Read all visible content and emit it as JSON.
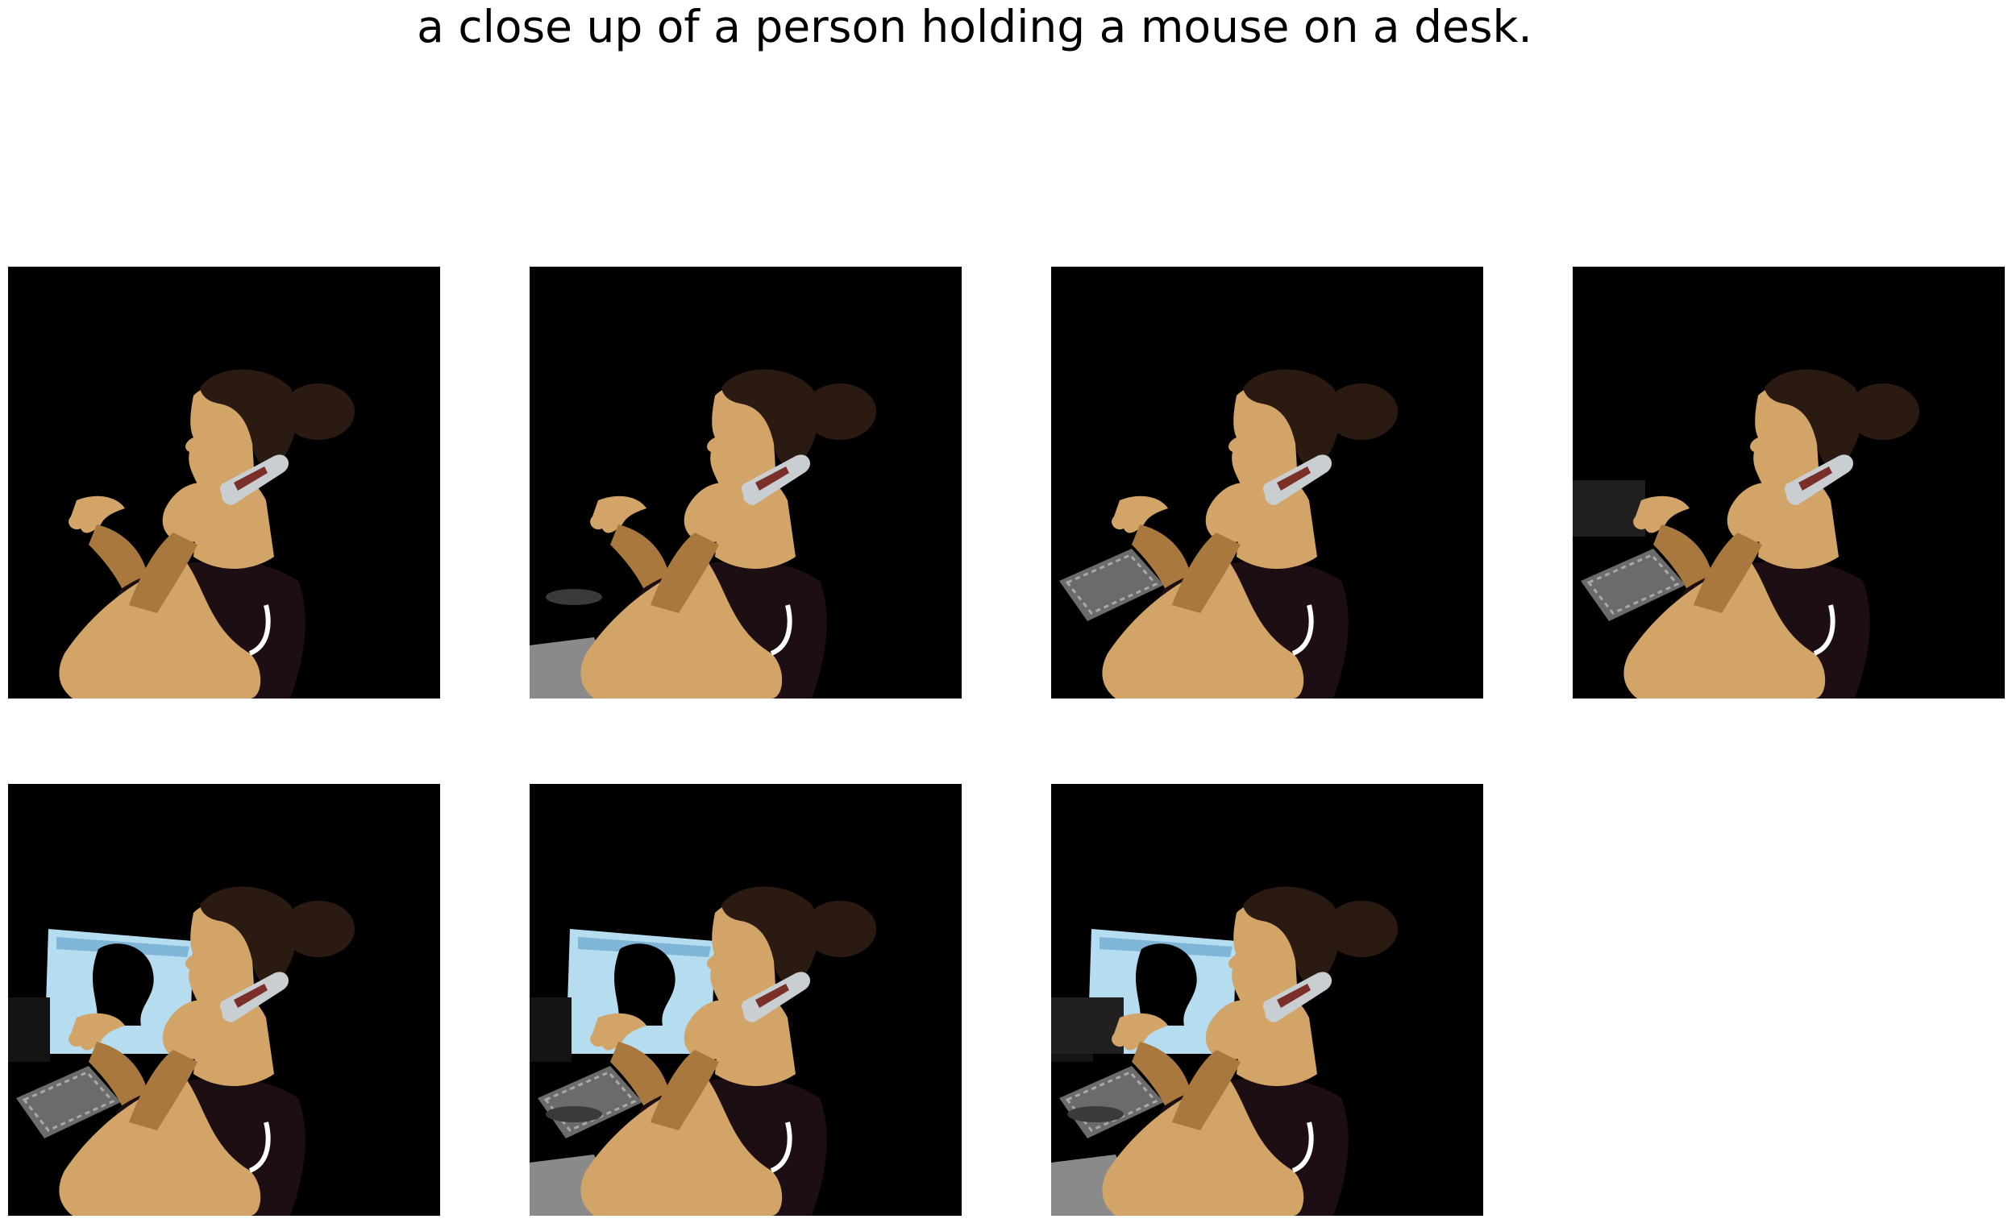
{
  "caption": "a close up of a person holding a mouse on a desk.",
  "panels": [
    {
      "name": "panel-1",
      "monitor": false,
      "keyboard": false,
      "desk": false,
      "mouse": false
    },
    {
      "name": "panel-2",
      "monitor": false,
      "keyboard": false,
      "desk": false,
      "mouse": true
    },
    {
      "name": "panel-3",
      "monitor": false,
      "keyboard": true,
      "desk": false,
      "mouse": false
    },
    {
      "name": "panel-4",
      "monitor": false,
      "keyboard": true,
      "desk": true,
      "mouse": false
    },
    {
      "name": "panel-5",
      "monitor": true,
      "keyboard": true,
      "desk": false,
      "mouse": false
    },
    {
      "name": "panel-6",
      "monitor": true,
      "keyboard": true,
      "desk": false,
      "mouse": true
    },
    {
      "name": "panel-7",
      "monitor": true,
      "keyboard": true,
      "desk": true,
      "mouse": true
    }
  ],
  "colors": {
    "background": "#000000",
    "skin": "#d2a468",
    "skin_shadow": "#a8783e",
    "hair": "#2a1a12",
    "shirt": "#1c0e12",
    "phone": "#c9ced2",
    "screen": "#b6dcf0",
    "keyboard": "#6b6b6b"
  }
}
